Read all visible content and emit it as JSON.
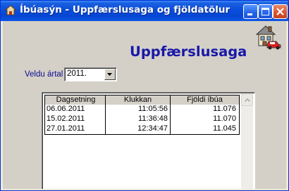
{
  "window": {
    "title": "Íbúasýn - Uppfærslusaga og fjöldatölur",
    "buttons": {
      "minimize": "minimize-icon",
      "maximize": "maximize-icon",
      "close": "close-icon"
    }
  },
  "header": {
    "heading": "Uppfærslusaga",
    "icon": "house-car-icon"
  },
  "year_filter": {
    "label": "Veldu ártal",
    "selected": "2011."
  },
  "table": {
    "columns": [
      "Dagsetning",
      "Klukkan",
      "Fjöldi íbúa"
    ],
    "rows": [
      [
        "06.06.2011",
        "11:05:56",
        "11.076"
      ],
      [
        "15.02.2011",
        "11:36:48",
        "11.070"
      ],
      [
        "27.01.2011",
        "12:34:47",
        "11.045"
      ]
    ]
  },
  "colors": {
    "titlebar": "#0a4fdb",
    "heading": "#1818a8",
    "label": "#0c0c8c",
    "panel": "#d4d0c8"
  }
}
